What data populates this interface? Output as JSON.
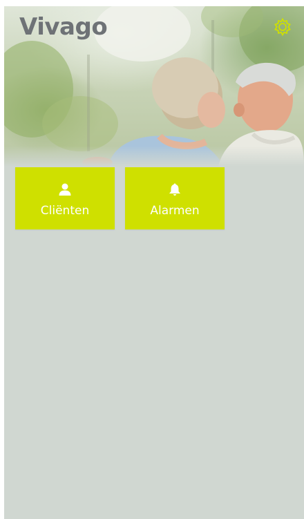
{
  "header": {
    "logo_text": "Vivago",
    "settings_icon": "gear-icon"
  },
  "tiles": [
    {
      "label": "Cliënten",
      "icon": "person-icon"
    },
    {
      "label": "Alarmen",
      "icon": "bell-icon"
    }
  ],
  "colors": {
    "accent": "#cfe000",
    "background": "#d0d7d1",
    "logo": "#6e7276",
    "tile_text": "#ffffff"
  }
}
